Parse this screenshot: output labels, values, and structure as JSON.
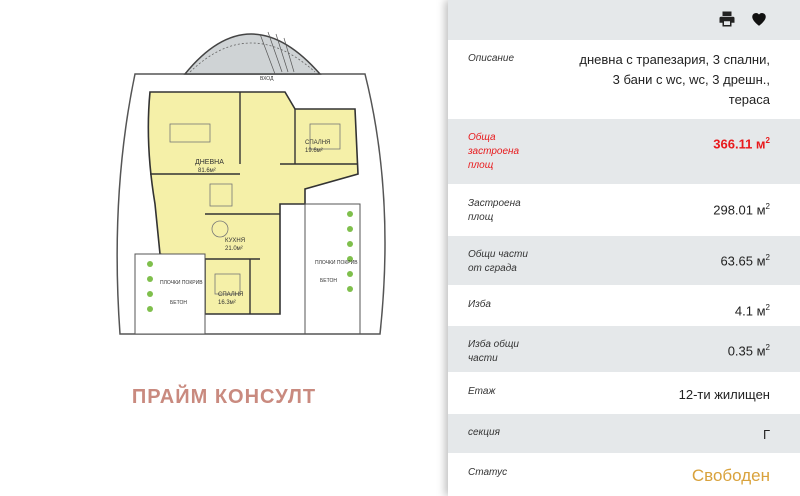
{
  "brand": "ПРАЙМ КОНСУЛТ",
  "toolbar": {
    "print_icon": "printer-icon",
    "fav_icon": "heart-icon"
  },
  "colors": {
    "panel_alt": "#e5e8ea",
    "accent_red": "#e8191c",
    "status": "#d9a23c",
    "brand": "#c98a7f"
  },
  "details": {
    "description": {
      "label": "Описание",
      "lines": [
        "дневна с трапезария, 3 спални,",
        "3 бани с wc, wc, 3 дрешн.,",
        "тераса"
      ]
    },
    "total_area": {
      "label_lines": [
        "Обща",
        "застроена",
        "площ"
      ],
      "value": "366.11 м",
      "unit_sup": "2"
    },
    "built_area": {
      "label_lines": [
        "Застроена",
        "площ"
      ],
      "value": "298.01 м",
      "unit_sup": "2"
    },
    "common_parts": {
      "label_lines": [
        "Общи части",
        "от сграда"
      ],
      "value": "63.65 м",
      "unit_sup": "2"
    },
    "storage": {
      "label": "Изба",
      "value": "4.1 м",
      "unit_sup": "2"
    },
    "storage_common": {
      "label_lines": [
        "Изба общи",
        "части"
      ],
      "value": "0.35 м",
      "unit_sup": "2"
    },
    "floor": {
      "label": "Етаж",
      "value": "12-ти жилищен"
    },
    "section": {
      "label": "секция",
      "value": "Г"
    },
    "status": {
      "label": "Статус",
      "value": "Свободен"
    }
  },
  "plan_labels": {
    "living": "ДНЕВНА",
    "living_area": "81.6м²",
    "kitchen": "КУХНЯ",
    "kitchen_area": "21.0м²",
    "bedroom1": "СПАЛНЯ",
    "bedroom1_area": "19.6м²",
    "bedroom2": "СПАЛНЯ",
    "bedroom2_area": "16.3м²",
    "terrace1": "ПЛОЧКИ ПОКРИВ",
    "terrace1_sub": "БЕТОН",
    "terrace2": "ПЛОЧКИ ПОКРИВ",
    "terrace2_sub": "БЕТОН",
    "entry": "ВХОД"
  }
}
